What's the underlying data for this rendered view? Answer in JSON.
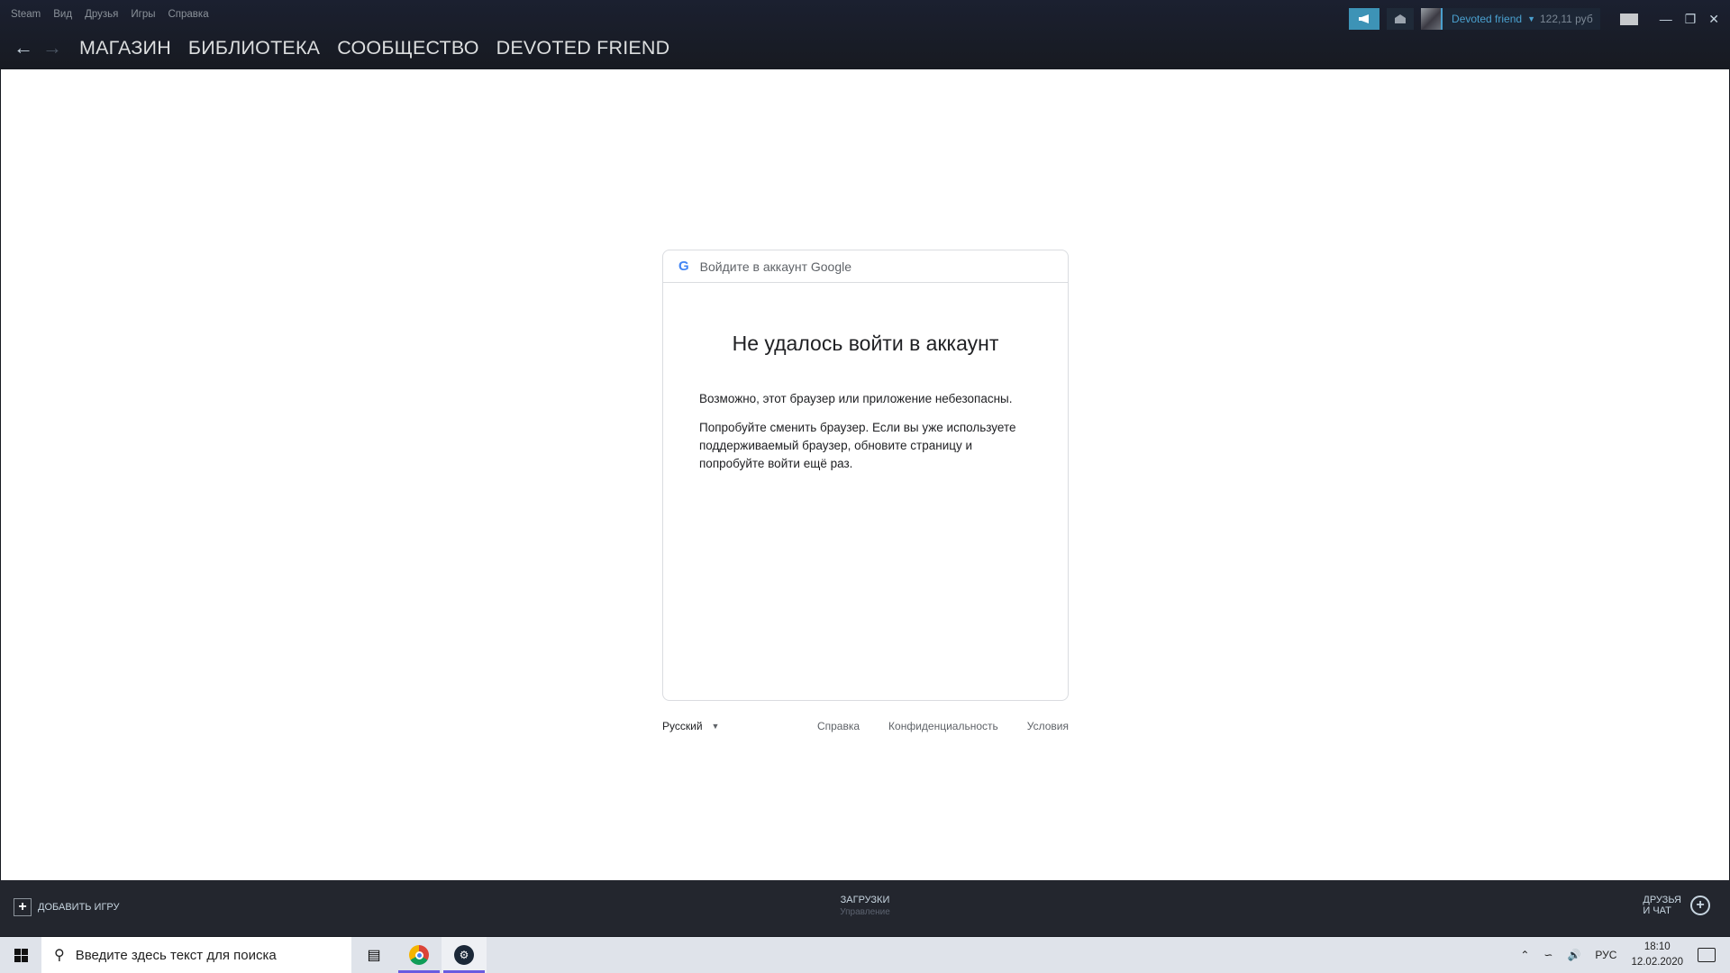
{
  "steam": {
    "menu": [
      "Steam",
      "Вид",
      "Друзья",
      "Игры",
      "Справка"
    ],
    "nav": [
      "МАГАЗИН",
      "БИБЛИОТЕКА",
      "СООБЩЕСТВО",
      "DEVOTED FRIEND"
    ],
    "user": {
      "name": "Devoted friend",
      "balance": "122,11 руб"
    },
    "icons": {
      "announce": "megaphone-icon",
      "mail": "envelope-icon",
      "bigpicture": "big-picture-icon"
    },
    "accent": "#3d93b6"
  },
  "google": {
    "header": "Войдите в аккаунт Google",
    "title": "Не удалось войти в аккаунт",
    "p1": "Возможно, этот браузер или приложение небезопасны.",
    "p2": "Попробуйте сменить браузер. Если вы уже используете поддерживаемый браузер, обновите страницу и попробуйте войти ещё раз.",
    "language": "Русский",
    "links": [
      "Справка",
      "Конфиденциальность",
      "Условия"
    ]
  },
  "bottombar": {
    "add_game": "ДОБАВИТЬ ИГРУ",
    "downloads": "ЗАГРУЗКИ",
    "downloads_sub": "Управление",
    "friends_line1": "ДРУЗЬЯ",
    "friends_line2": "И ЧАТ"
  },
  "taskbar": {
    "search_placeholder": "Введите здесь текст для поиска",
    "lang": "РУС",
    "time": "18:10",
    "date": "12.02.2020"
  }
}
